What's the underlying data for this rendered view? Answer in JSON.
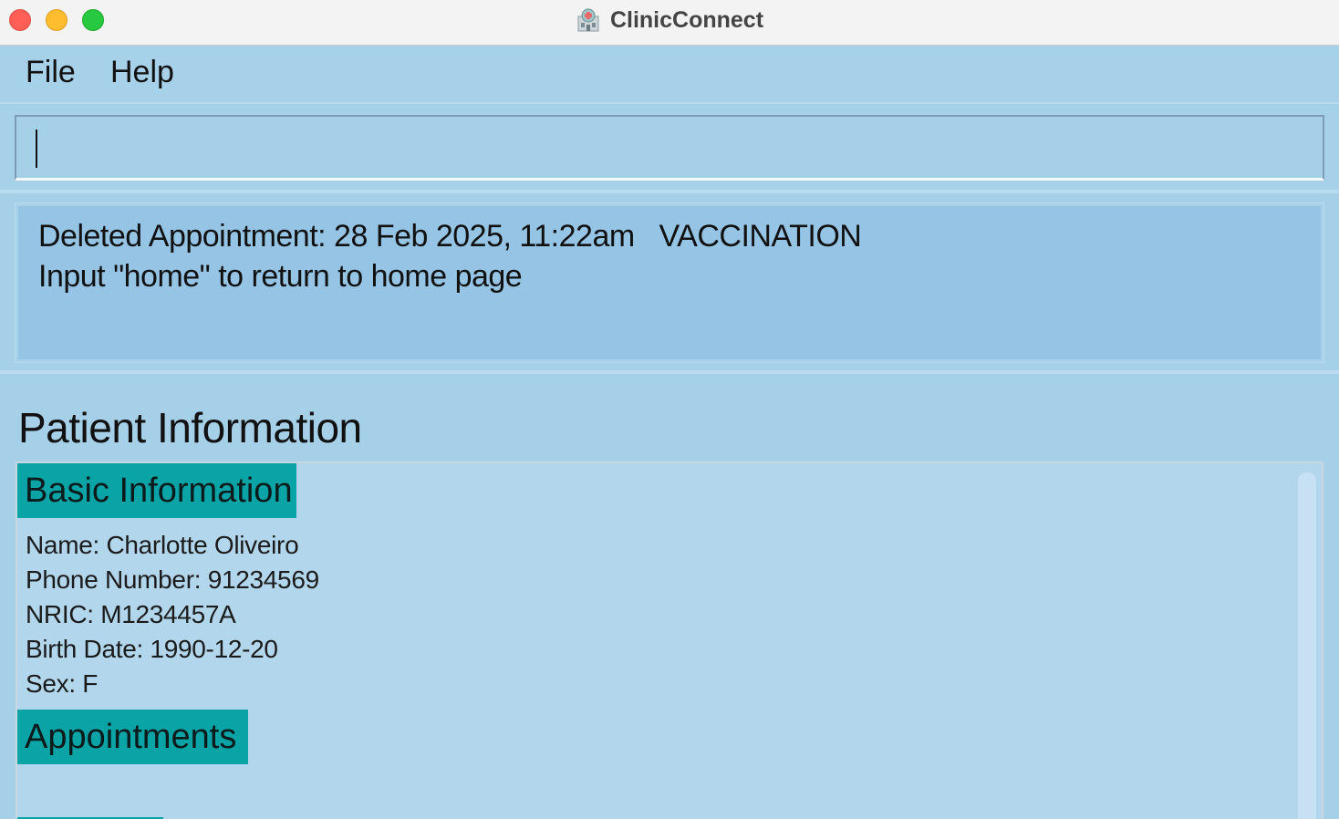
{
  "window": {
    "title": "ClinicConnect",
    "app_icon": "clinic-building-icon"
  },
  "menu": {
    "items": [
      {
        "label": "File"
      },
      {
        "label": "Help"
      }
    ]
  },
  "command_box": {
    "value": "",
    "placeholder": ""
  },
  "result_display": {
    "line1": "Deleted Appointment: 28 Feb 2025, 11:22am   VACCINATION",
    "line2": "Input \"home\" to return to home page"
  },
  "patient": {
    "section_title": "Patient Information",
    "basic_header": "Basic Information",
    "name": "Name: Charlotte Oliveiro",
    "phone": "Phone Number: 91234569",
    "nric": "NRIC: M1234457A",
    "birth_date": "Birth Date: 1990-12-20",
    "sex": "Sex: F",
    "appointments_header": "Appointments"
  },
  "colors": {
    "background": "#a6cfe8",
    "result_bg": "#95c4e5",
    "section_header_bg": "#0aa3a6",
    "panel_bg": "#b2d6ec"
  }
}
